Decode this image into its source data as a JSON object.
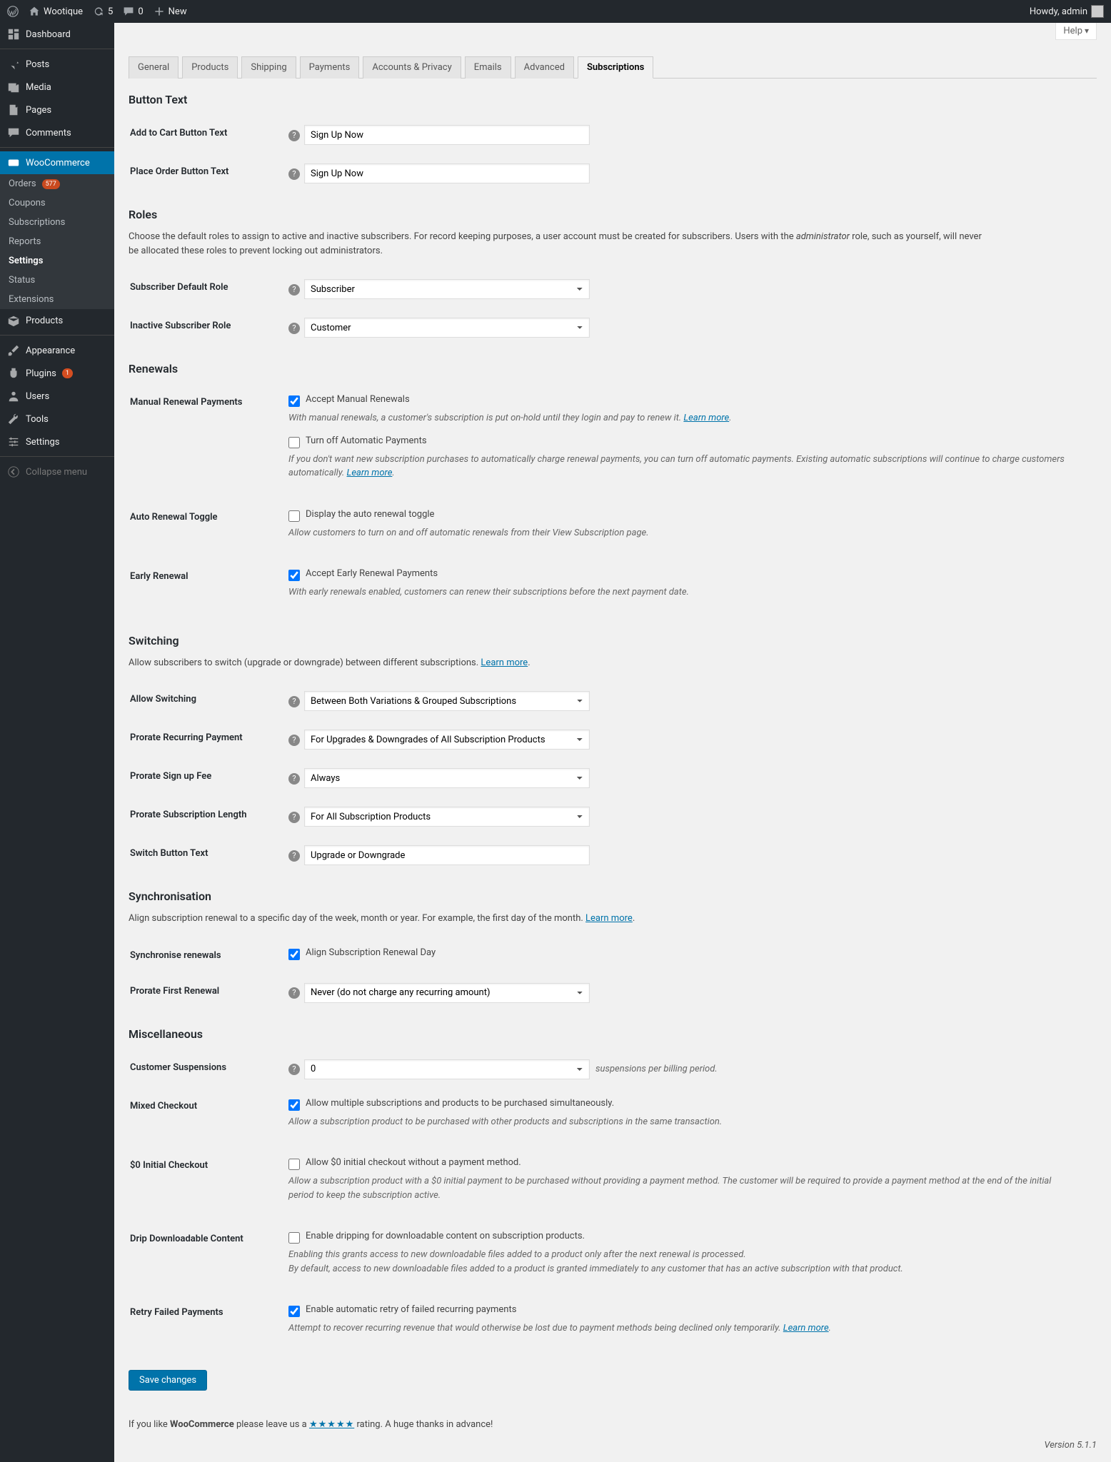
{
  "adminbar": {
    "site": "Wootique",
    "updates": "5",
    "comments": "0",
    "new": "New",
    "howdy": "Howdy, admin"
  },
  "sidebar": {
    "dashboard": "Dashboard",
    "posts": "Posts",
    "media": "Media",
    "pages": "Pages",
    "comments": "Comments",
    "woocommerce": "WooCommerce",
    "orders": "Orders",
    "orders_badge": "577",
    "coupons": "Coupons",
    "subscriptions": "Subscriptions",
    "reports": "Reports",
    "settings": "Settings",
    "status": "Status",
    "extensions": "Extensions",
    "products": "Products",
    "appearance": "Appearance",
    "plugins": "Plugins",
    "plugins_badge": "1",
    "users": "Users",
    "tools": "Tools",
    "wp_settings": "Settings",
    "collapse": "Collapse menu"
  },
  "help": "Help",
  "tabs": [
    "General",
    "Products",
    "Shipping",
    "Payments",
    "Accounts & Privacy",
    "Emails",
    "Advanced",
    "Subscriptions"
  ],
  "sections": {
    "button_text": "Button Text",
    "roles": "Roles",
    "renewals": "Renewals",
    "switching": "Switching",
    "sync": "Synchronisation",
    "misc": "Miscellaneous"
  },
  "labels": {
    "add_to_cart": "Add to Cart Button Text",
    "place_order": "Place Order Button Text",
    "sub_default_role": "Subscriber Default Role",
    "inactive_role": "Inactive Subscriber Role",
    "manual_renew": "Manual Renewal Payments",
    "auto_toggle": "Auto Renewal Toggle",
    "early_renew": "Early Renewal",
    "allow_switch": "Allow Switching",
    "prorate_recur": "Prorate Recurring Payment",
    "prorate_signup": "Prorate Sign up Fee",
    "prorate_length": "Prorate Subscription Length",
    "switch_btn": "Switch Button Text",
    "sync_renew": "Synchronise renewals",
    "prorate_first": "Prorate First Renewal",
    "cust_susp": "Customer Suspensions",
    "mixed_chk": "Mixed Checkout",
    "zero_init": "$0 Initial Checkout",
    "drip": "Drip Downloadable Content",
    "retry": "Retry Failed Payments"
  },
  "values": {
    "add_to_cart": "Sign Up Now",
    "place_order": "Sign Up Now",
    "sub_default_role": "Subscriber",
    "inactive_role": "Customer",
    "allow_switch": "Between Both Variations & Grouped Subscriptions",
    "prorate_recur": "For Upgrades & Downgrades of All Subscription Products",
    "prorate_signup": "Always",
    "prorate_length": "For All Subscription Products",
    "switch_btn": "Upgrade or Downgrade",
    "prorate_first": "Never (do not charge any recurring amount)",
    "cust_susp": "0"
  },
  "checkboxes": {
    "accept_manual": "Accept Manual Renewals",
    "turn_off_auto": "Turn off Automatic Payments",
    "display_toggle": "Display the auto renewal toggle",
    "accept_early": "Accept Early Renewal Payments",
    "align_day": "Align Subscription Renewal Day",
    "mixed": "Allow multiple subscriptions and products to be purchased simultaneously.",
    "zero": "Allow $0 initial checkout without a payment method.",
    "drip": "Enable dripping for downloadable content on subscription products.",
    "retry": "Enable automatic retry of failed recurring payments"
  },
  "text": {
    "roles_desc_1": "Choose the default roles to assign to active and inactive subscribers. For record keeping purposes, a user account must be created for subscribers. Users with the ",
    "roles_desc_em": "administrator",
    "roles_desc_2": " role, such as yourself, will never be allocated these roles to prevent locking out administrators.",
    "manual_desc": "With manual renewals, a customer's subscription is put on-hold until they login and pay to renew it. ",
    "learn_more": "Learn more",
    "turnoff_desc": "If you don't want new subscription purchases to automatically charge renewal payments, you can turn off automatic payments. Existing automatic subscriptions will continue to charge customers automatically. ",
    "toggle_desc": "Allow customers to turn on and off automatic renewals from their View Subscription page.",
    "early_desc": "With early renewals enabled, customers can renew their subscriptions before the next payment date.",
    "switch_desc": "Allow subscribers to switch (upgrade or downgrade) between different subscriptions. ",
    "sync_desc": "Align subscription renewal to a specific day of the week, month or year. For example, the first day of the month. ",
    "susp_note": "suspensions per billing period.",
    "mixed_desc": "Allow a subscription product to be purchased with other products and subscriptions in the same transaction.",
    "zero_desc": "Allow a subscription product with a $0 initial payment to be purchased without providing a payment method. The customer will be required to provide a payment method at the end of the initial period to keep the subscription active.",
    "drip_desc1": "Enabling this grants access to new downloadable files added to a product only after the next renewal is processed.",
    "drip_desc2": "By default, access to new downloadable files added to a product is granted immediately to any customer that has an active subscription with that product.",
    "retry_desc": "Attempt to recover recurring revenue that would otherwise be lost due to payment methods being declined only temporarily. "
  },
  "save": "Save changes",
  "footer": {
    "p1": "If you like ",
    "p2": "WooCommerce",
    "p3": " please leave us a ",
    "stars": "★★★★★",
    "p4": " rating. A huge thanks in advance!",
    "version": "Version 5.1.1"
  }
}
